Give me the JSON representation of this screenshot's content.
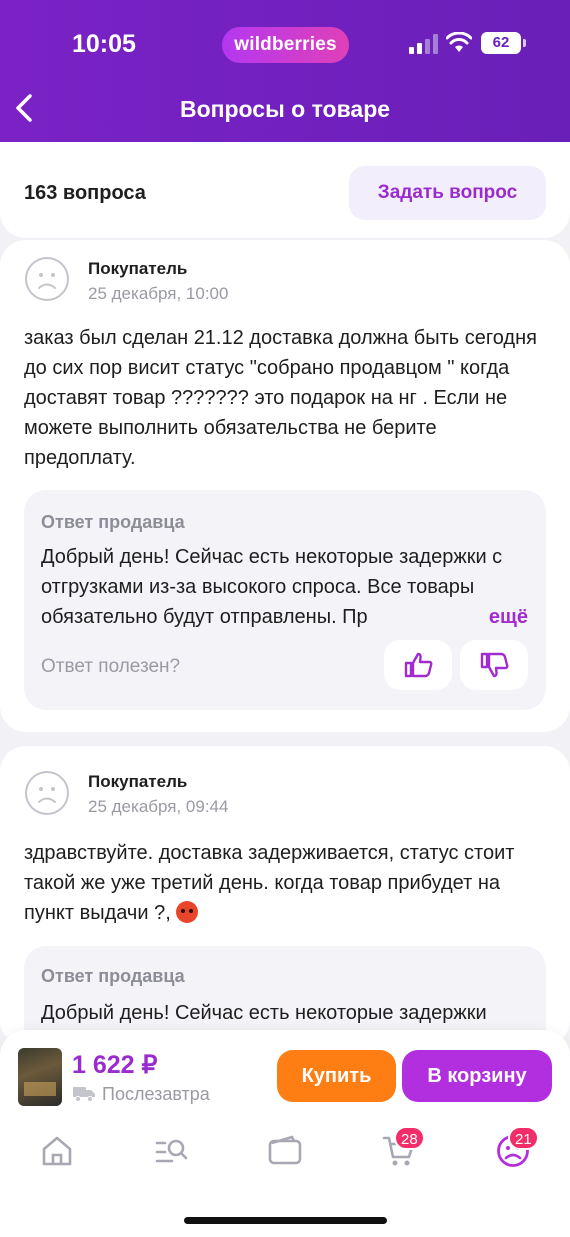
{
  "status_bar": {
    "time": "10:05",
    "brand": "wildberries",
    "battery": "62"
  },
  "header": {
    "title": "Вопросы о товаре"
  },
  "summary": {
    "count": "163 вопроса",
    "ask_button": "Задать вопрос"
  },
  "questions": [
    {
      "author": "Покупатель",
      "date": "25 декабря, 10:00",
      "text": "заказ был сделан 21.12 доставка должна быть сегодня до сих пор висит статус \"собрано продавцом \" когда доставят товар ??????? это подарок на нг . Если не можете выполнить обязательства не берите предоплату.",
      "answer_label": "Ответ продавца",
      "answer_text": "Добрый день! Сейчас есть некоторые задержки с отгрузками из-за высокого спроса. Все товары обязательно будут отправлены. Пр",
      "more_label": "ещё",
      "useful_label": "Ответ полезен?"
    },
    {
      "author": "Покупатель",
      "date": "25 декабря, 09:44",
      "text": "здравствуйте. доставка задерживается, статус стоит такой же уже третий день. когда товар прибудет на пункт выдачи ?,",
      "answer_label": "Ответ продавца",
      "answer_text": "Добрый день! Сейчас есть некоторые задержки"
    }
  ],
  "buy_bar": {
    "price": "1 622 ₽",
    "delivery": "Послезавтра",
    "buy_button": "Купить",
    "cart_button": "В корзину"
  },
  "tab_bar": {
    "cart_badge": "28",
    "profile_badge": "21"
  },
  "colors": {
    "brand": "#6a1fb8",
    "accent": "#b22fe0",
    "buy": "#ff7e13",
    "badge": "#f22d6a"
  },
  "icons": [
    "back-arrow-icon",
    "signal-icon",
    "wifi-icon",
    "avatar-icon",
    "thumbs-up-icon",
    "thumbs-down-icon",
    "truck-icon",
    "home-icon",
    "catalog-search-icon",
    "wallet-icon",
    "cart-icon",
    "profile-icon"
  ]
}
